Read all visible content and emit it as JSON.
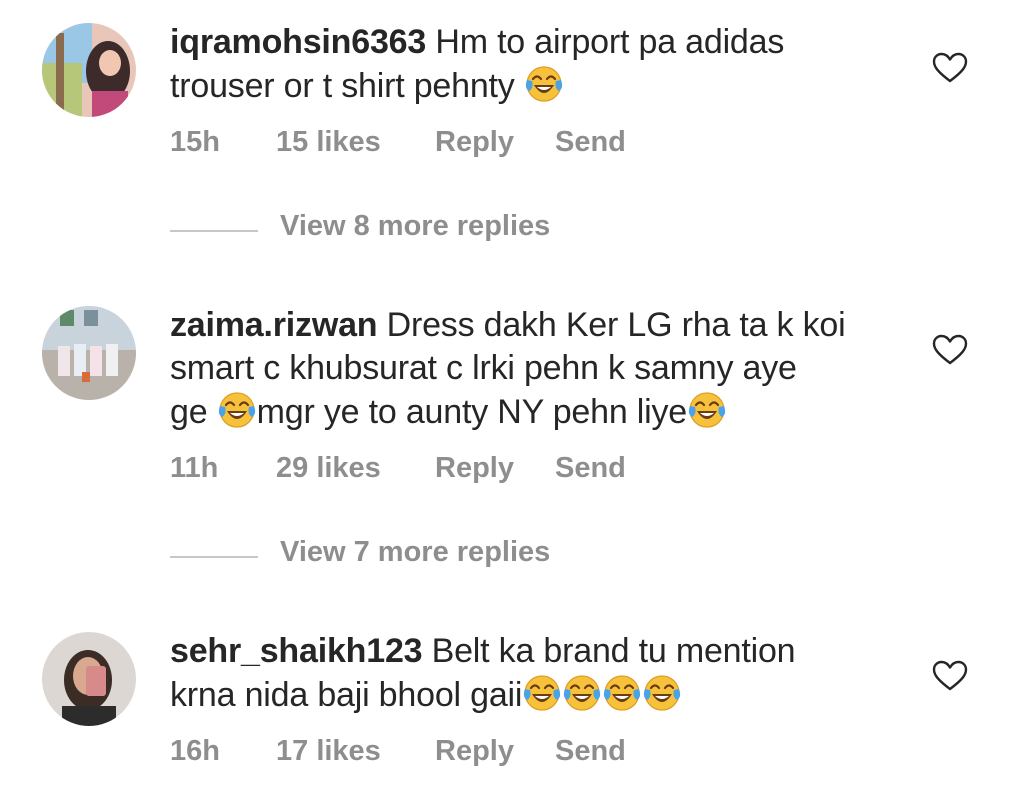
{
  "comments": [
    {
      "username": "iqramohsin6363",
      "text_lines": [
        "Hm to airport pa adidas",
        "trouser or t shirt pehnty"
      ],
      "time": "15h",
      "likes": "15 likes",
      "reply_label": "Reply",
      "send_label": "Send",
      "view_replies": "View 8 more replies",
      "like_icon": "heart-outline-icon"
    },
    {
      "username": "zaima.rizwan",
      "text_lines": [
        "Dress dakh Ker LG rha ta k koi",
        "smart c khubsurat c lrki pehn k samny aye",
        "ge",
        "mgr ye to aunty NY pehn liye"
      ],
      "time": "11h",
      "likes": "29 likes",
      "reply_label": "Reply",
      "send_label": "Send",
      "view_replies": "View 7 more replies",
      "like_icon": "heart-outline-icon"
    },
    {
      "username": "sehr_shaikh123",
      "text_lines": [
        "Belt ka brand tu mention",
        "krna nida baji bhool gaii"
      ],
      "time": "16h",
      "likes": "17 likes",
      "reply_label": "Reply",
      "send_label": "Send",
      "like_icon": "heart-outline-icon"
    }
  ],
  "emoji": "face-with-tears-of-joy",
  "colors": {
    "text": "#262626",
    "meta": "#8e8e8e",
    "divider": "#c7c7c7",
    "emoji_face": "#f7c23b"
  }
}
